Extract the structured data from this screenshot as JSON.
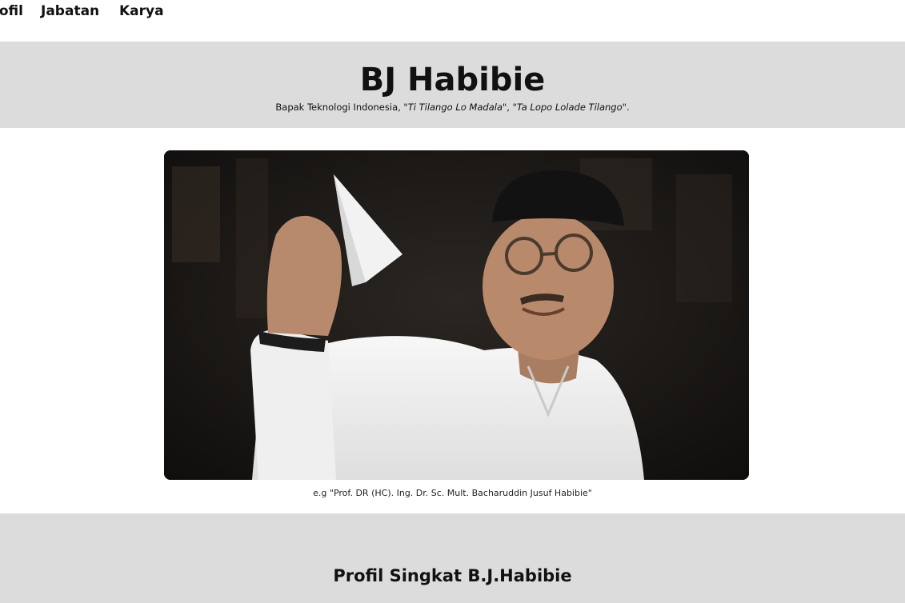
{
  "nav": {
    "items": [
      {
        "label": "Profil"
      },
      {
        "label": "Jabatan"
      },
      {
        "label": "Karya"
      }
    ]
  },
  "hero": {
    "title": "BJ Habibie",
    "tagline_prefix": "Bapak Teknologi Indonesia, \"",
    "tagline_quote1": "Ti Tilango Lo Madala",
    "tagline_mid": "\", \"",
    "tagline_quote2": "Ta Lopo Lolade Tilango",
    "tagline_suffix": "\"."
  },
  "figure": {
    "caption": "e.g \"Prof. DR (HC). Ing. Dr. Sc. Mult. Bacharuddin Jusuf Habibie\""
  },
  "profile": {
    "heading": "Profil Singkat B.J.Habibie"
  }
}
